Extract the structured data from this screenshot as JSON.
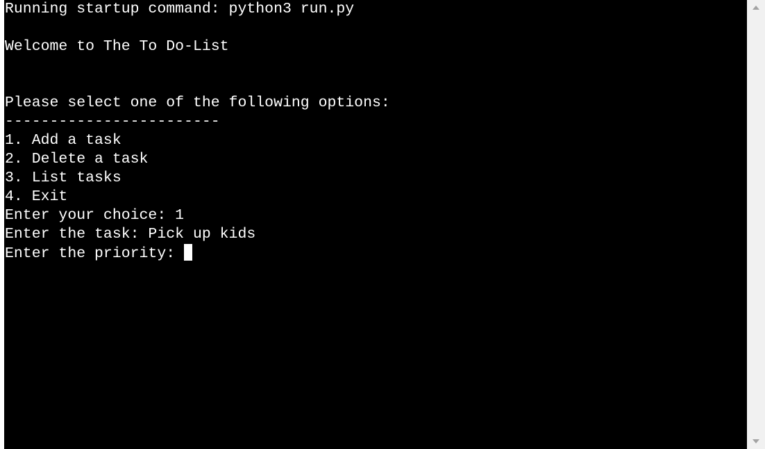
{
  "terminal": {
    "startup_line": "Running startup command: python3 run.py",
    "welcome_line": "Welcome to The To Do-List",
    "prompt_heading": "Please select one of the following options:",
    "separator": "------------------------",
    "menu_options": [
      "1. Add a task",
      "2. Delete a task",
      "3. List tasks",
      "4. Exit"
    ],
    "choice_line": "Enter your choice: 1",
    "task_line": "Enter the task: Pick up kids",
    "priority_prompt": "Enter the priority: "
  },
  "colors": {
    "terminal_bg": "#000000",
    "terminal_fg": "#ffffff",
    "scrollbar_bg": "#f1f1f1",
    "scroll_arrow": "#a3a3a3"
  },
  "icons": {
    "scroll_up": "scroll-up-arrow-icon",
    "scroll_down": "scroll-down-arrow-icon"
  }
}
